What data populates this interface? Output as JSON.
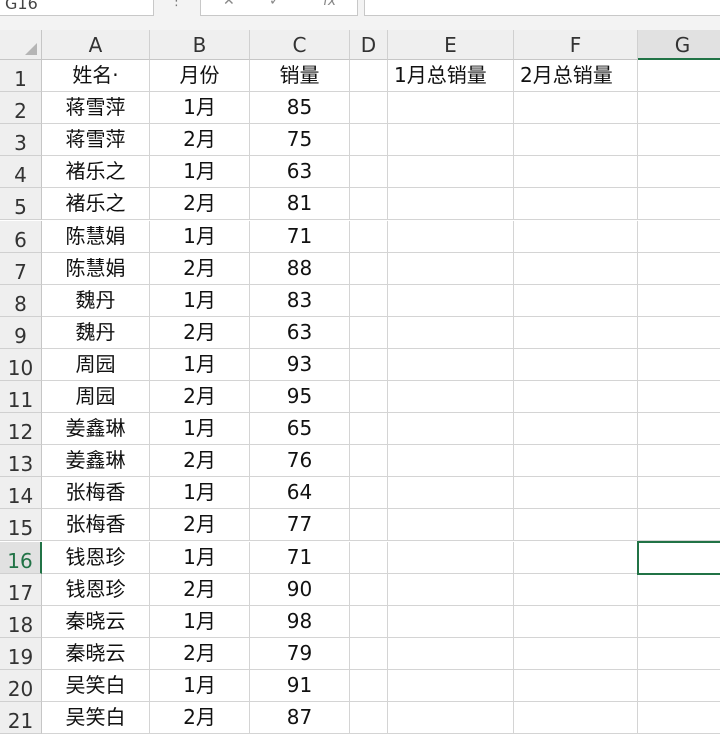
{
  "name_box": {
    "value": "G16"
  },
  "formula_bar": {
    "value": ""
  },
  "columns": [
    "A",
    "B",
    "C",
    "D",
    "E",
    "F",
    "G"
  ],
  "rows": [
    {
      "num": "1",
      "A": "姓名·",
      "B": "月份",
      "C": "销量",
      "E": "1月总销量",
      "F": "2月总销量"
    },
    {
      "num": "2",
      "A": "蒋雪萍",
      "B": "1月",
      "C": "85"
    },
    {
      "num": "3",
      "A": "蒋雪萍",
      "B": "2月",
      "C": "75"
    },
    {
      "num": "4",
      "A": "褚乐之",
      "B": "1月",
      "C": "63"
    },
    {
      "num": "5",
      "A": "褚乐之",
      "B": "2月",
      "C": "81"
    },
    {
      "num": "6",
      "A": "陈慧娟",
      "B": "1月",
      "C": "71"
    },
    {
      "num": "7",
      "A": "陈慧娟",
      "B": "2月",
      "C": "88"
    },
    {
      "num": "8",
      "A": "魏丹",
      "B": "1月",
      "C": "83"
    },
    {
      "num": "9",
      "A": "魏丹",
      "B": "2月",
      "C": "63"
    },
    {
      "num": "10",
      "A": "周园",
      "B": "1月",
      "C": "93"
    },
    {
      "num": "11",
      "A": "周园",
      "B": "2月",
      "C": "95"
    },
    {
      "num": "12",
      "A": "姜鑫琳",
      "B": "1月",
      "C": "65"
    },
    {
      "num": "13",
      "A": "姜鑫琳",
      "B": "2月",
      "C": "76"
    },
    {
      "num": "14",
      "A": "张梅香",
      "B": "1月",
      "C": "64"
    },
    {
      "num": "15",
      "A": "张梅香",
      "B": "2月",
      "C": "77"
    },
    {
      "num": "16",
      "A": "钱恩珍",
      "B": "1月",
      "C": "71"
    },
    {
      "num": "17",
      "A": "钱恩珍",
      "B": "2月",
      "C": "90"
    },
    {
      "num": "18",
      "A": "秦晓云",
      "B": "1月",
      "C": "98"
    },
    {
      "num": "19",
      "A": "秦晓云",
      "B": "2月",
      "C": "79"
    },
    {
      "num": "20",
      "A": "吴笑白",
      "B": "1月",
      "C": "91"
    },
    {
      "num": "21",
      "A": "吴笑白",
      "B": "2月",
      "C": "87"
    }
  ],
  "selection": {
    "column": "G",
    "row": "16"
  },
  "colors": {
    "accent": "#217346"
  }
}
